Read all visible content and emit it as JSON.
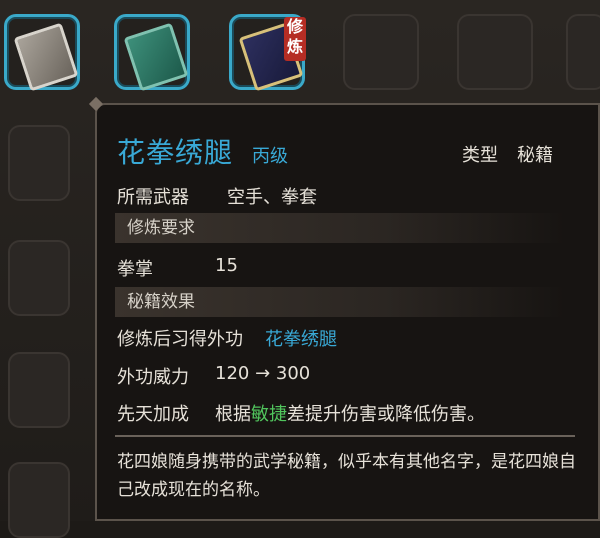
{
  "slots": [
    {
      "icon": "gray-book-icon"
    },
    {
      "icon": "green-book-icon"
    },
    {
      "icon": "scroll-book-icon",
      "tag": "修炼"
    }
  ],
  "tooltip": {
    "title": "花拳绣腿",
    "grade": "丙级",
    "type_label": "类型",
    "type_value": "秘籍",
    "weapon_label": "所需武器",
    "weapon_value": "空手、拳套",
    "section_req": "修炼要求",
    "req_label": "拳掌",
    "req_value": "15",
    "section_effect": "秘籍效果",
    "effect_label": "修炼后习得外功",
    "effect_value": "花拳绣腿",
    "power_label": "外功威力",
    "power_value": "120 → 300",
    "innate_label": "先天加成",
    "innate_pre": "根据",
    "innate_hl": "敏捷",
    "innate_post": "差提升伤害或降低伤害。",
    "description": "花四娘随身携带的武学秘籍，似乎本有其他名字，是花四娘自己改成现在的名称。"
  },
  "colors": {
    "accent": "#39a9d6",
    "highlight": "#51c55d",
    "text": "#e6e1d8"
  }
}
